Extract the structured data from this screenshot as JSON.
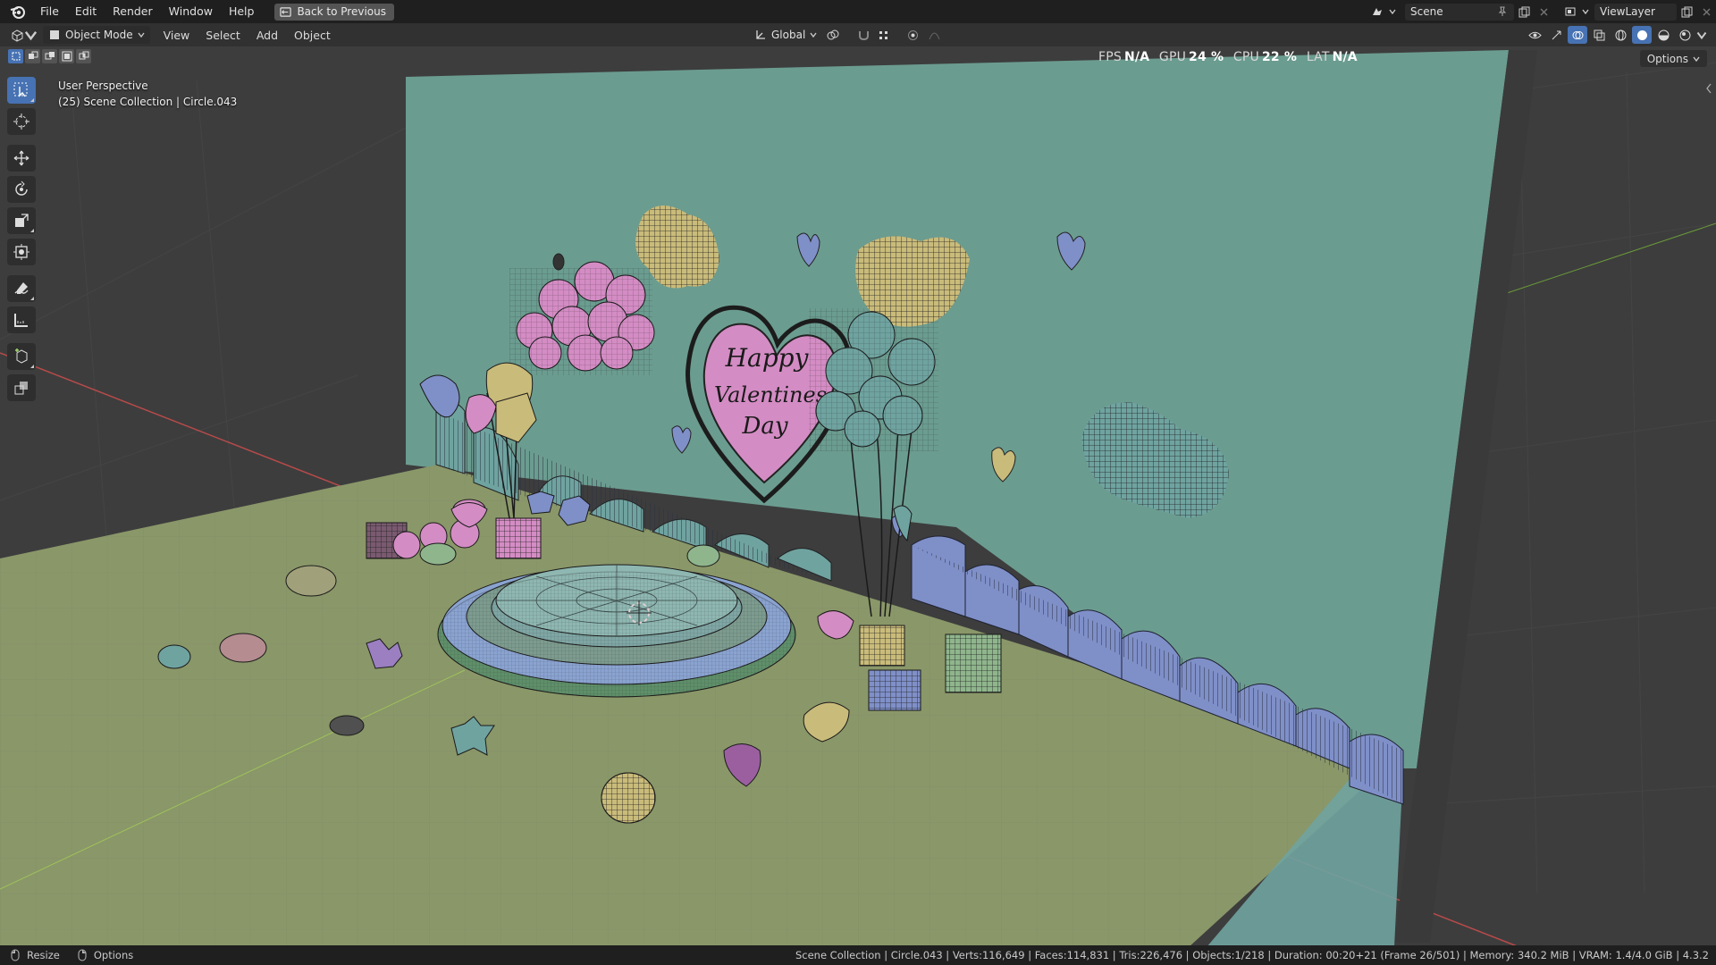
{
  "app": {
    "logo_icon": "blender-logo-icon"
  },
  "menu": {
    "items": [
      "File",
      "Edit",
      "Render",
      "Window",
      "Help"
    ],
    "back_button": "Back to Previous"
  },
  "scene_selector": {
    "value": "Scene"
  },
  "viewlayer_selector": {
    "value": "ViewLayer"
  },
  "viewport_header": {
    "mode": "Object Mode",
    "menus": [
      "View",
      "Select",
      "Add",
      "Object"
    ],
    "transform_orientation": "Global"
  },
  "stats": {
    "fps_label": "FPS",
    "fps_value": "N/A",
    "gpu_label": "GPU",
    "gpu_value": "24 %",
    "cpu_label": "CPU",
    "cpu_value": "22 %",
    "lat_label": "LAT",
    "lat_value": "N/A"
  },
  "viewport": {
    "view_name": "User Perspective",
    "collection_info": "(25) Scene Collection | Circle.043",
    "options_label": "Options",
    "card_text": [
      "Happy",
      "Valentines",
      "Day"
    ]
  },
  "toolbar": {
    "tools": [
      "select-box-icon",
      "cursor-icon",
      "move-icon",
      "rotate-icon",
      "scale-icon",
      "transform-icon",
      "annotate-icon",
      "measure-icon",
      "add-cube-icon",
      "extrude-icon"
    ]
  },
  "statusbar": {
    "left": [
      "Resize",
      "Options"
    ],
    "info": "Scene Collection | Circle.043 | Verts:116,649 | Faces:114,831 | Tris:226,476 | Objects:1/218 | Duration: 00:20+21 (Frame 26/501) | Memory: 340.2 MiB | VRAM: 1.4/4.0 GiB | 4.3.2"
  },
  "colors": {
    "wall": "#6b9c90",
    "floor": "#8a9769",
    "pink": "#d48cc4",
    "teal": "#6fa3a0",
    "yellow": "#c9bb7a",
    "blue": "#7f8fc8",
    "accent": "#4772b3"
  }
}
